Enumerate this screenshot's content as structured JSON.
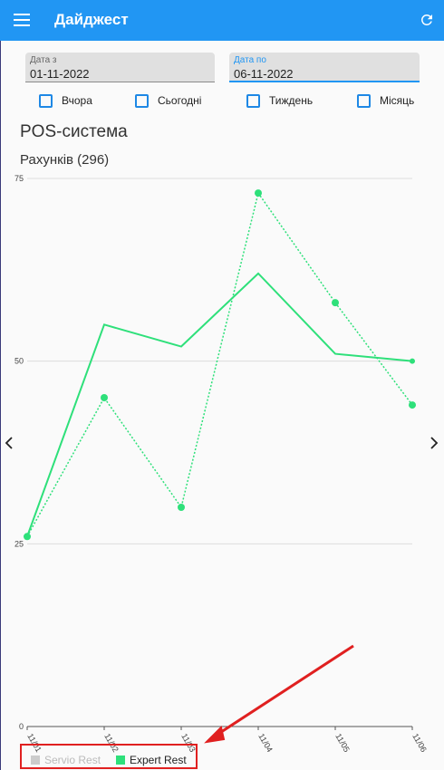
{
  "app": {
    "title": "Дайджест"
  },
  "filters": {
    "date_from": {
      "label": "Дата з",
      "value": "01-11-2022"
    },
    "date_to": {
      "label": "Дата по",
      "value": "06-11-2022"
    },
    "checkboxes": [
      {
        "label": "Вчора",
        "checked": false
      },
      {
        "label": "Сьогодні",
        "checked": false
      },
      {
        "label": "Тиждень",
        "checked": false
      },
      {
        "label": "Місяць",
        "checked": false
      }
    ]
  },
  "section": {
    "title": "POS-система",
    "count_label": "Рахунків (296)"
  },
  "chart_data": {
    "type": "line",
    "categories": [
      "11/01",
      "11/02",
      "11/03",
      "11/04",
      "11/05",
      "11/06"
    ],
    "ylim": [
      0,
      75
    ],
    "yticks": [
      "0",
      "25",
      "50",
      "75"
    ],
    "grid": true,
    "series": [
      {
        "name": "Expert Rest",
        "style": "solid",
        "color": "#2ee07a",
        "values": [
          26,
          55,
          52,
          62,
          51,
          50
        ]
      },
      {
        "name": "Expert Rest",
        "style": "dotted",
        "color": "#2ee07a",
        "values": [
          26,
          45,
          30,
          73,
          58,
          44
        ]
      }
    ],
    "legend": [
      {
        "name": "Servio Rest",
        "color": "#cccccc",
        "active": false
      },
      {
        "name": "Expert Rest",
        "color": "#2ee07a",
        "active": true
      }
    ],
    "legend_position": "bottom-left"
  },
  "colors": {
    "primary": "#2196f3",
    "annotation": "#e02020"
  }
}
